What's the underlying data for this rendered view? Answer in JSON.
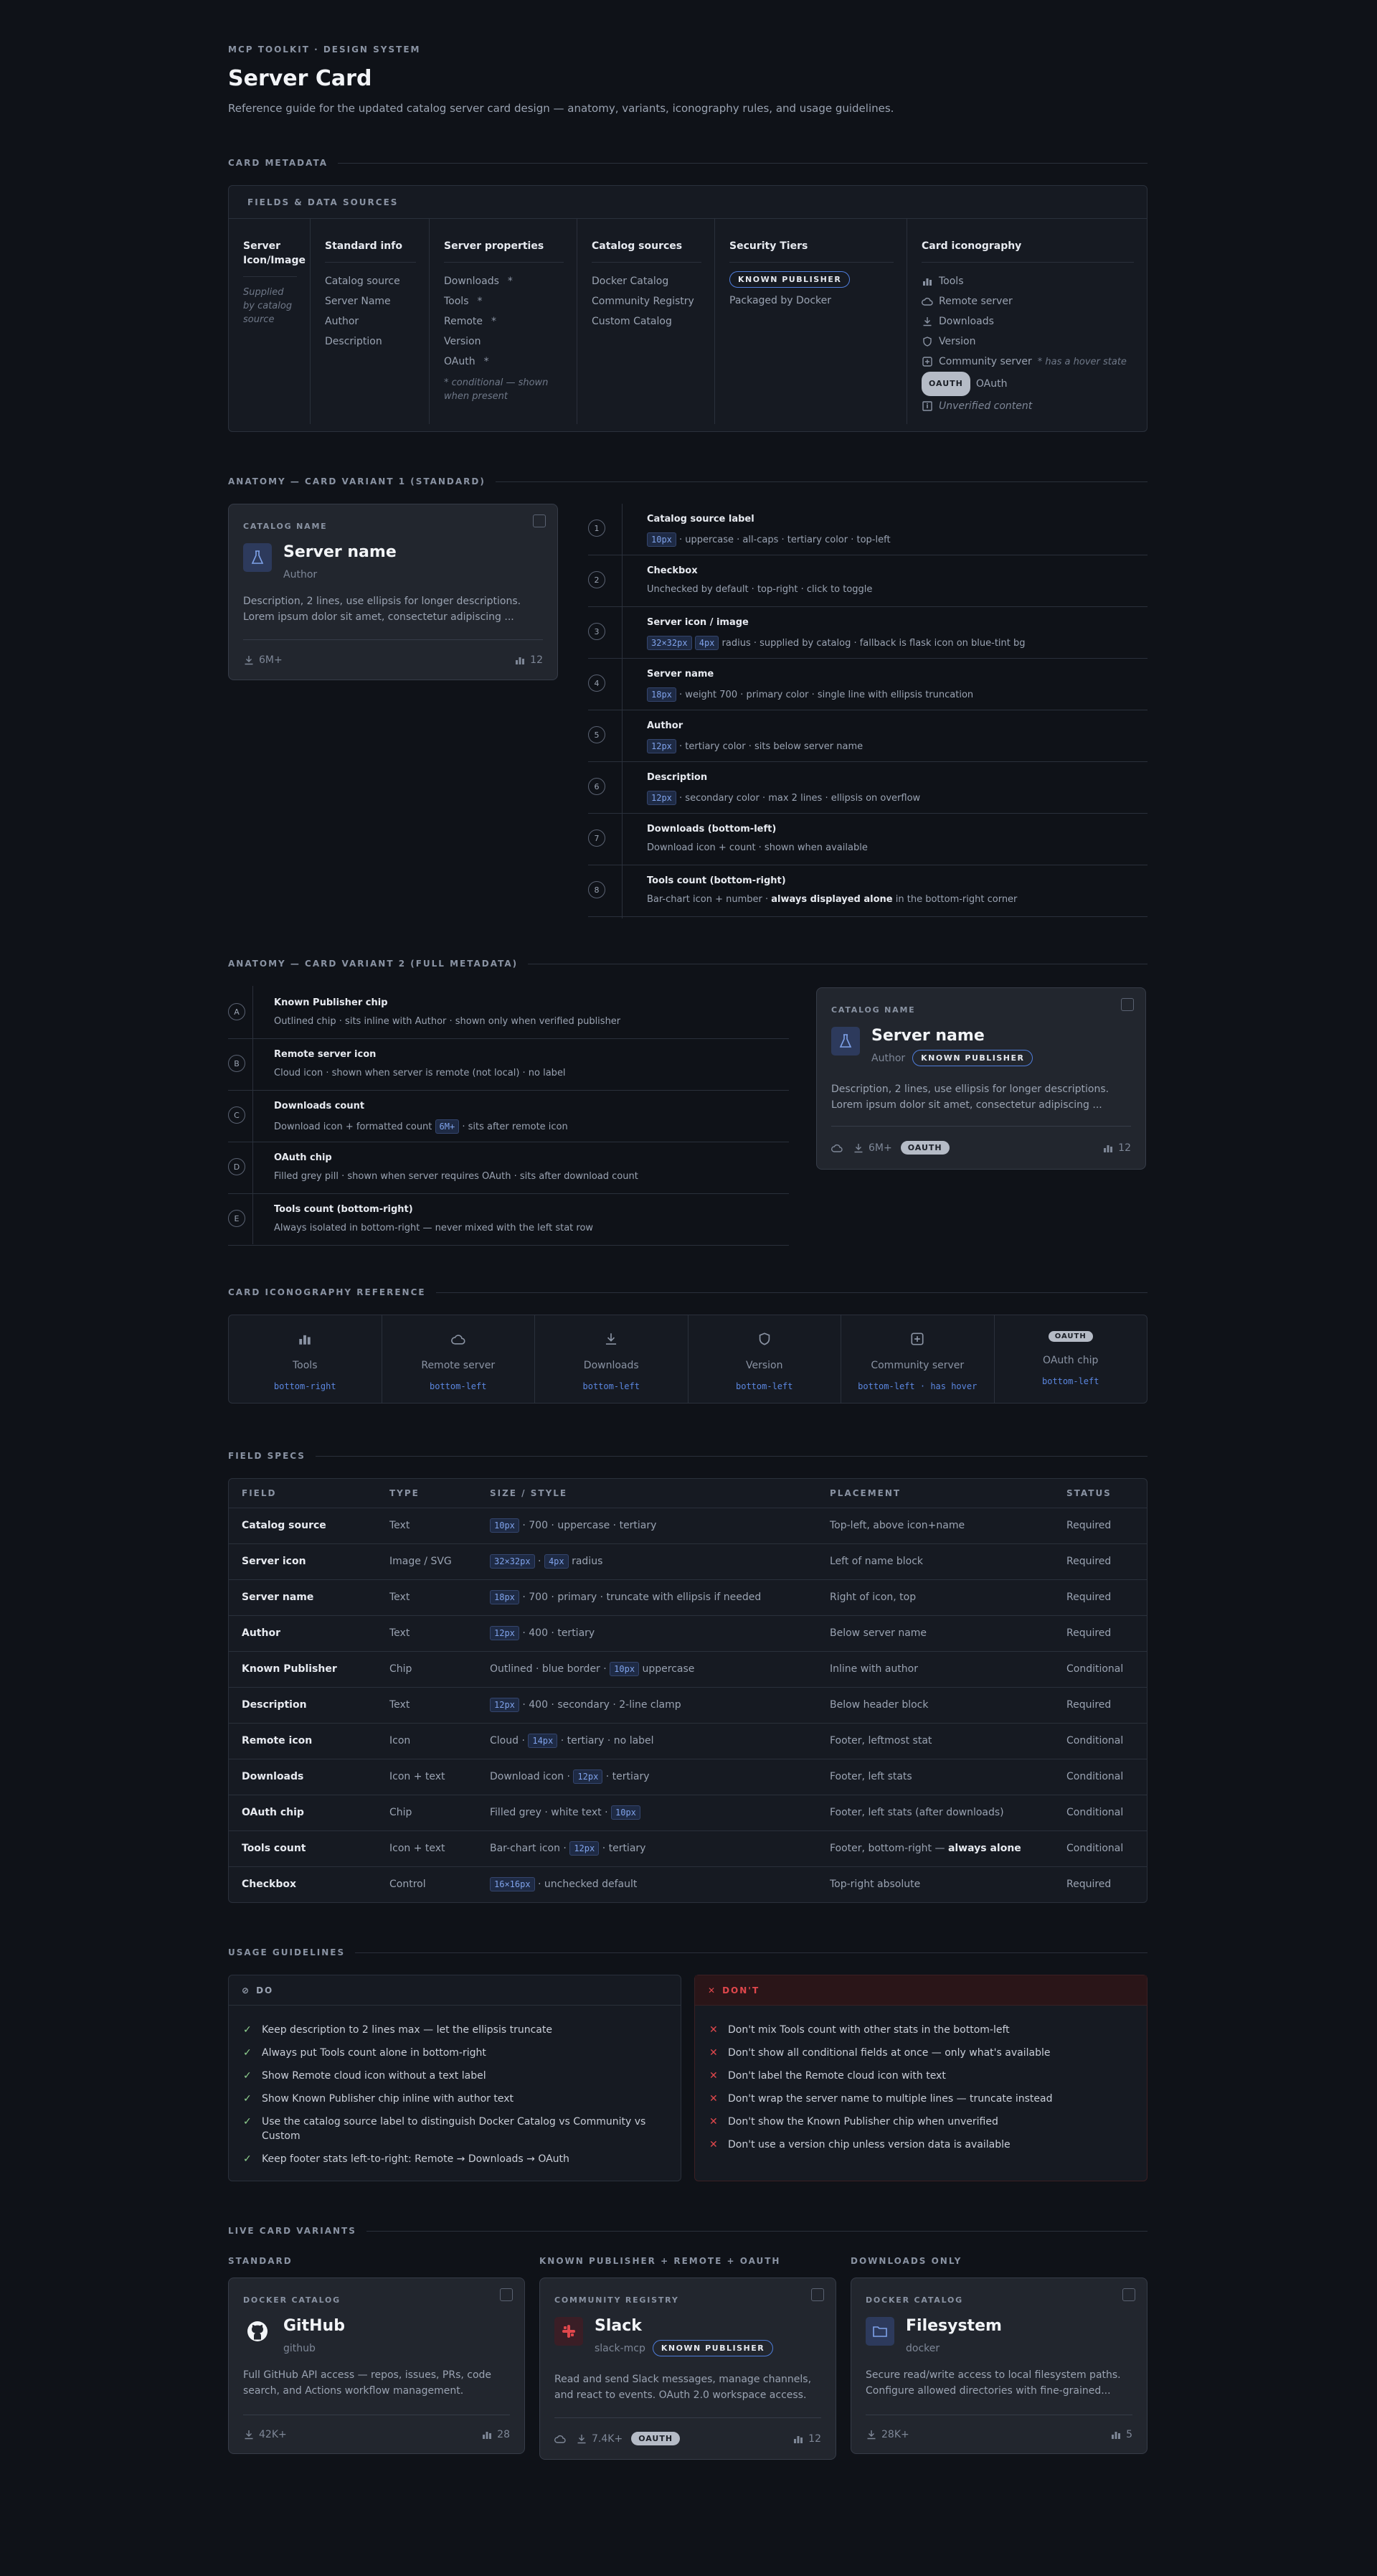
{
  "header": {
    "eyebrow": "MCP TOOLKIT · DESIGN SYSTEM",
    "title": "Server Card",
    "subtitle": "Reference guide for the updated catalog server card design — anatomy, variants, iconography rules, and usage guidelines."
  },
  "sections": {
    "metadata": "CARD METADATA",
    "variant1": "ANATOMY — CARD VARIANT 1 (STANDARD)",
    "variant2": "ANATOMY — CARD VARIANT 2 (FULL METADATA)",
    "iconography": "CARD ICONOGRAPHY REFERENCE",
    "specs": "FIELD SPECS",
    "usage": "USAGE GUIDELINES",
    "live": "LIVE CARD VARIANTS"
  },
  "metadata": {
    "panel_title": "FIELDS & DATA SOURCES",
    "col1": {
      "title": "Server Icon/Image",
      "note": "Supplied by catalog source"
    },
    "col2": {
      "title": "Standard info",
      "items": [
        "Catalog source",
        "Server Name",
        "Author",
        "Description"
      ]
    },
    "col3": {
      "title": "Server properties",
      "items": [
        "Downloads",
        "Tools",
        "Remote",
        "Version",
        "OAuth"
      ],
      "stars": [
        "*",
        "*",
        "*",
        "",
        "*"
      ],
      "note": "* conditional — shown when present"
    },
    "col4": {
      "title": "Catalog sources",
      "items": [
        "Docker Catalog",
        "Community Registry",
        "Custom Catalog"
      ]
    },
    "col5": {
      "title": "Security Tiers",
      "chip": "KNOWN PUBLISHER",
      "item": "Packaged by Docker"
    },
    "col6": {
      "title": "Card iconography",
      "items": [
        "Tools",
        "Remote server",
        "Downloads",
        "Version",
        "Community server"
      ],
      "hover_note": "* has a hover state",
      "oauth_chip": "OAUTH",
      "oauth_label": "OAuth",
      "unverified": "Unverified content",
      "icons": [
        "bar-chart-icon",
        "cloud-icon",
        "download-icon",
        "shield-icon",
        "plus-square-icon"
      ]
    }
  },
  "card1": {
    "catalog": "CATALOG NAME",
    "name": "Server name",
    "author": "Author",
    "desc": "Description, 2 lines, use ellipsis for longer descriptions. Lorem ipsum dolor sit amet, consectetur adipiscing ...",
    "downloads": "6M+",
    "tools": "12"
  },
  "anatomy1": [
    {
      "n": "1",
      "title": "Catalog source label",
      "code": "10px",
      "desc": "· uppercase · all-caps · tertiary color · top-left"
    },
    {
      "n": "2",
      "title": "Checkbox",
      "code": "",
      "desc": "Unchecked by default · top-right · click to toggle"
    },
    {
      "n": "3",
      "title": "Server icon / image",
      "code": "32×32px",
      "code2": "4px",
      "desc": "radius · supplied by catalog · fallback is flask icon on blue-tint bg"
    },
    {
      "n": "4",
      "title": "Server name",
      "code": "18px",
      "desc": "· weight 700 · primary color · single line with ellipsis truncation"
    },
    {
      "n": "5",
      "title": "Author",
      "code": "12px",
      "desc": "· tertiary color · sits below server name"
    },
    {
      "n": "6",
      "title": "Description",
      "code": "12px",
      "desc": "· secondary color · max 2 lines · ellipsis on overflow"
    },
    {
      "n": "7",
      "title": "Downloads (bottom-left)",
      "code": "",
      "desc": "Download icon + count · shown when available"
    },
    {
      "n": "8",
      "title": "Tools count (bottom-right)",
      "code": "",
      "desc": "Bar-chart icon + number ·",
      "bold": "always displayed alone",
      "desc2": "in the bottom-right corner"
    }
  ],
  "anatomy2": [
    {
      "n": "A",
      "title": "Known Publisher chip",
      "desc": "Outlined chip · sits inline with Author · shown only when verified publisher"
    },
    {
      "n": "B",
      "title": "Remote server icon",
      "desc": "Cloud icon · shown when server is remote (not local) · no label"
    },
    {
      "n": "C",
      "title": "Downloads count",
      "desc": "Download icon + formatted count",
      "code": "6M+",
      "desc2": "· sits after remote icon"
    },
    {
      "n": "D",
      "title": "OAuth chip",
      "desc": "Filled grey pill · shown when server requires OAuth · sits after download count"
    },
    {
      "n": "E",
      "title": "Tools count (bottom-right)",
      "desc": "Always isolated in bottom-right — never mixed with the left stat row"
    }
  ],
  "card2": {
    "catalog": "CATALOG NAME",
    "name": "Server name",
    "author": "Author",
    "chip": "KNOWN PUBLISHER",
    "desc": "Description, 2 lines, use ellipsis for longer descriptions. Lorem ipsum dolor sit amet, consectetur adipiscing ...",
    "downloads": "6M+",
    "oauth": "OAUTH",
    "tools": "12"
  },
  "iconref": [
    {
      "label": "Tools",
      "place": "bottom-right",
      "place2": ""
    },
    {
      "label": "Remote server",
      "place": "bottom-left",
      "place2": ""
    },
    {
      "label": "Downloads",
      "place": "bottom-left",
      "place2": ""
    },
    {
      "label": "Version",
      "place": "bottom-left",
      "place2": ""
    },
    {
      "label": "Community server",
      "place": "bottom-left",
      "place2": "has hover"
    },
    {
      "label": "OAuth chip",
      "place": "bottom-left",
      "place2": "",
      "chip": "OAUTH"
    }
  ],
  "specs": {
    "headers": [
      "FIELD",
      "TYPE",
      "SIZE / STYLE",
      "PLACEMENT",
      "STATUS"
    ],
    "rows": [
      {
        "f": "Catalog source",
        "t": "Text",
        "c": [
          "10px"
        ],
        "s": "· 700 · uppercase · tertiary",
        "p": "Top-left, above icon+name",
        "st": "Required"
      },
      {
        "f": "Server icon",
        "t": "Image / SVG",
        "c": [
          "32×32px",
          "4px"
        ],
        "s": "radius",
        "p": "Left of name block",
        "st": "Required"
      },
      {
        "f": "Server name",
        "t": "Text",
        "c": [
          "18px"
        ],
        "s": "· 700 · primary · truncate with ellipsis if needed",
        "p": "Right of icon, top",
        "st": "Required"
      },
      {
        "f": "Author",
        "t": "Text",
        "c": [
          "12px"
        ],
        "s": "· 400 · tertiary",
        "p": "Below server name",
        "st": "Required"
      },
      {
        "f": "Known Publisher",
        "t": "Chip",
        "pre": "Outlined · blue border ·",
        "c": [
          "10px"
        ],
        "s": "uppercase",
        "p": "Inline with author",
        "st": "Conditional"
      },
      {
        "f": "Description",
        "t": "Text",
        "c": [
          "12px"
        ],
        "s": "· 400 · secondary · 2-line clamp",
        "p": "Below header block",
        "st": "Required"
      },
      {
        "f": "Remote icon",
        "t": "Icon",
        "pre": "Cloud ·",
        "c": [
          "14px"
        ],
        "s": "· tertiary · no label",
        "p": "Footer, leftmost stat",
        "st": "Conditional"
      },
      {
        "f": "Downloads",
        "t": "Icon + text",
        "pre": "Download icon ·",
        "c": [
          "12px"
        ],
        "s": "· tertiary",
        "p": "Footer, left stats",
        "st": "Conditional"
      },
      {
        "f": "OAuth chip",
        "t": "Chip",
        "pre": "Filled grey · white text ·",
        "c": [
          "10px"
        ],
        "s": "",
        "p": "Footer, left stats (after downloads)",
        "st": "Conditional"
      },
      {
        "f": "Tools count",
        "t": "Icon + text",
        "pre": "Bar-chart icon ·",
        "c": [
          "12px"
        ],
        "s": "· tertiary",
        "p": "Footer, bottom-right —",
        "pb": "always alone",
        "st": "Conditional"
      },
      {
        "f": "Checkbox",
        "t": "Control",
        "c": [
          "16×16px"
        ],
        "s": "· unchecked default",
        "p": "Top-right absolute",
        "st": "Required"
      }
    ]
  },
  "usage": {
    "do_title": "DO",
    "dont_title": "DON'T",
    "do": [
      "Keep description to 2 lines max — let the ellipsis truncate",
      "Always put Tools count alone in bottom-right",
      "Show Remote cloud icon without a text label",
      "Show Known Publisher chip inline with author text",
      "Use the catalog source label to distinguish Docker Catalog vs Community vs Custom",
      "Keep footer stats left-to-right: Remote → Downloads → OAuth"
    ],
    "dont": [
      "Don't mix Tools count with other stats in the bottom-left",
      "Don't show all conditional fields at once — only what's available",
      "Don't label the Remote cloud icon with text",
      "Don't wrap the server name to multiple lines — truncate instead",
      "Don't show the Known Publisher chip when unverified",
      "Don't use a version chip unless version data is available"
    ]
  },
  "live": {
    "labels": [
      "STANDARD",
      "KNOWN PUBLISHER + REMOTE + OAUTH",
      "DOWNLOADS ONLY"
    ],
    "github": {
      "catalog": "DOCKER CATALOG",
      "name": "GitHub",
      "author": "github",
      "desc": "Full GitHub API access — repos, issues, PRs, code search, and Actions workflow management.",
      "downloads": "42K+",
      "tools": "28"
    },
    "slack": {
      "catalog": "COMMUNITY REGISTRY",
      "name": "Slack",
      "author": "slack-mcp",
      "chip": "KNOWN PUBLISHER",
      "desc": "Read and send Slack messages, manage channels, and react to events. OAuth 2.0 workspace access.",
      "downloads": "7.4K+",
      "oauth": "OAUTH",
      "tools": "12"
    },
    "fs": {
      "catalog": "DOCKER CATALOG",
      "name": "Filesystem",
      "author": "docker",
      "desc": "Secure read/write access to local filesystem paths. Configure allowed directories with fine-grained...",
      "downloads": "28K+",
      "tools": "5"
    }
  },
  "colors": {
    "accent": "#5b87e0",
    "bg": "#0f1218",
    "card": "#22262e",
    "do": "#8fd18f",
    "dont": "#e0474c"
  }
}
